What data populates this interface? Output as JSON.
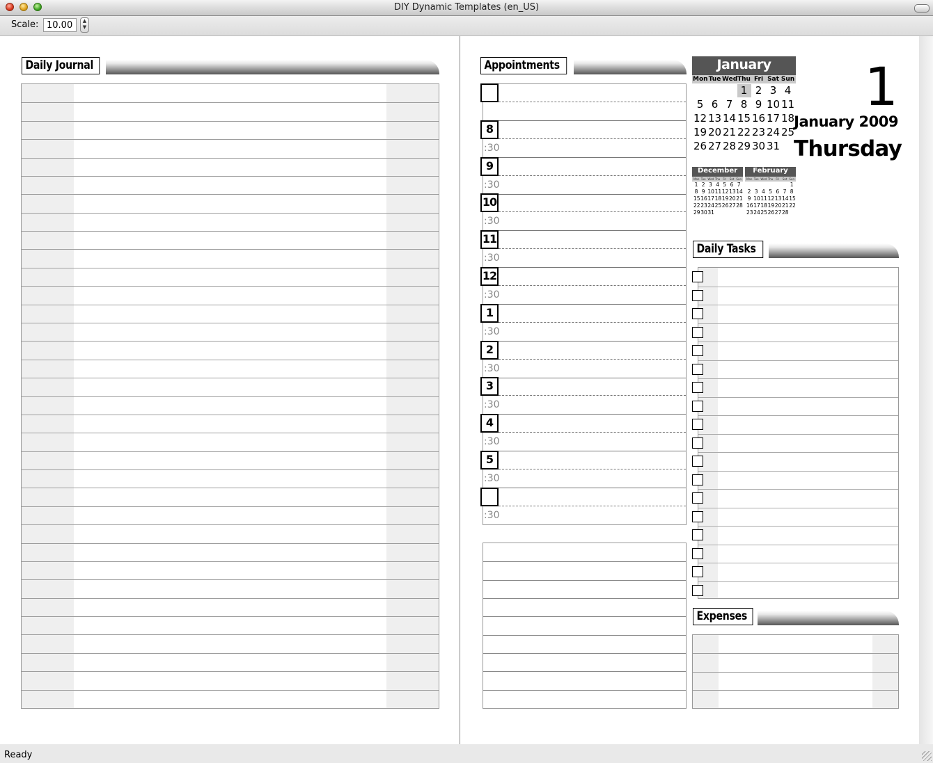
{
  "window": {
    "title": "DIY Dynamic Templates (en_US)"
  },
  "toolbar": {
    "scale_label": "Scale:",
    "scale_value": "10.00"
  },
  "status": {
    "text": "Ready"
  },
  "journal": {
    "title": "Daily Journal",
    "row_count": 34
  },
  "appointments": {
    "title": "Appointments",
    "hours": [
      "",
      "8",
      "9",
      "10",
      "11",
      "12",
      "1",
      "2",
      "3",
      "4",
      "5",
      ""
    ],
    "half_label": ":30",
    "note_lines": 9
  },
  "calendar": {
    "month": "January",
    "weekdays": [
      "Mon",
      "Tue",
      "Wed",
      "Thu",
      "Fri",
      "Sat",
      "Sun"
    ],
    "weeks": [
      [
        "",
        "",
        "",
        "1",
        "2",
        "3",
        "4"
      ],
      [
        "5",
        "6",
        "7",
        "8",
        "9",
        "10",
        "11"
      ],
      [
        "12",
        "13",
        "14",
        "15",
        "16",
        "17",
        "18"
      ],
      [
        "19",
        "20",
        "21",
        "22",
        "23",
        "24",
        "25"
      ],
      [
        "26",
        "27",
        "28",
        "29",
        "30",
        "31",
        ""
      ]
    ],
    "highlight_day": "1",
    "prev_month": {
      "name": "December",
      "weeks": [
        [
          "1",
          "2",
          "3",
          "4",
          "5",
          "6",
          "7"
        ],
        [
          "8",
          "9",
          "10",
          "11",
          "12",
          "13",
          "14"
        ],
        [
          "15",
          "16",
          "17",
          "18",
          "19",
          "20",
          "21"
        ],
        [
          "22",
          "23",
          "24",
          "25",
          "26",
          "27",
          "28"
        ],
        [
          "29",
          "30",
          "31",
          "",
          "",
          "",
          ""
        ]
      ]
    },
    "next_month": {
      "name": "February",
      "weeks": [
        [
          "",
          "",
          "",
          "",
          "",
          "",
          "1"
        ],
        [
          "2",
          "3",
          "4",
          "5",
          "6",
          "7",
          "8"
        ],
        [
          "9",
          "10",
          "11",
          "12",
          "13",
          "14",
          "15"
        ],
        [
          "16",
          "17",
          "18",
          "19",
          "20",
          "21",
          "22"
        ],
        [
          "23",
          "24",
          "25",
          "26",
          "27",
          "28",
          ""
        ]
      ]
    }
  },
  "date": {
    "day_number": "1",
    "month_year": "January 2009",
    "weekday": "Thursday"
  },
  "tasks": {
    "title": "Daily Tasks",
    "count": 18
  },
  "expenses": {
    "title": "Expenses",
    "rows": 4
  }
}
